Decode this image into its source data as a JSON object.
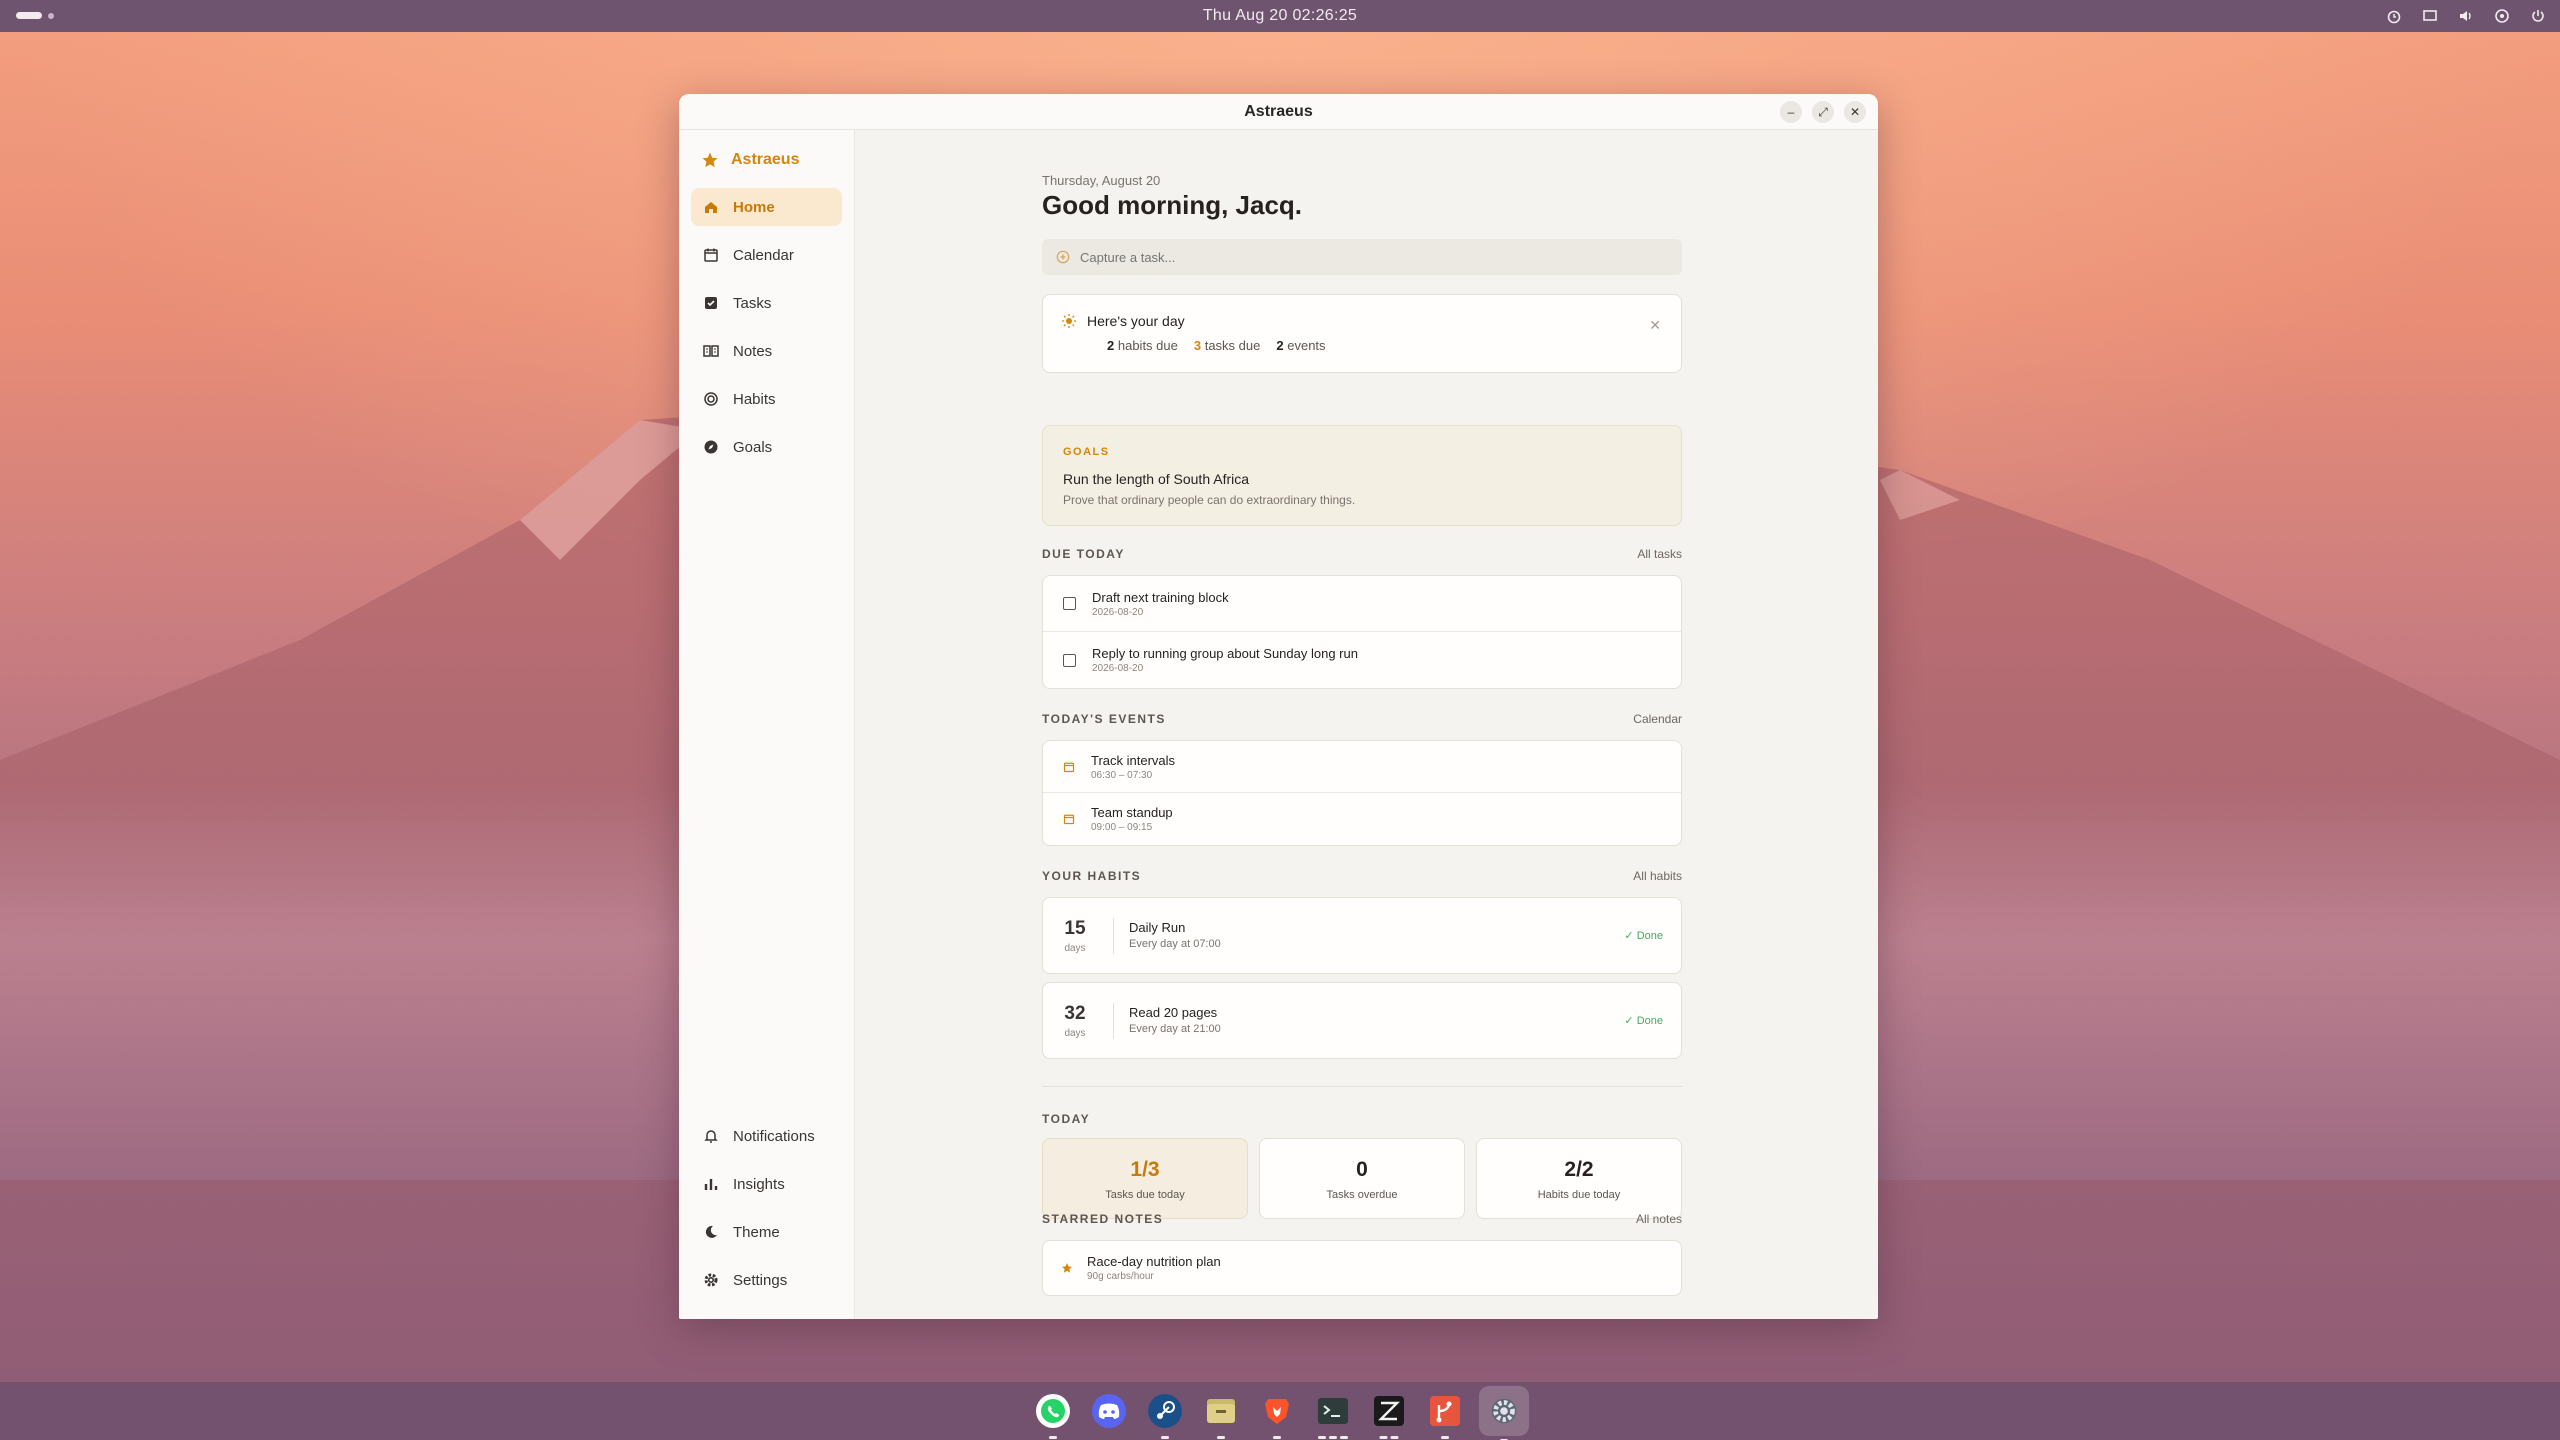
{
  "topbar": {
    "clock": "Thu Aug 20  02:26:25"
  },
  "window": {
    "title": "Astraeus"
  },
  "sidebar": {
    "brand": "Astraeus",
    "items": [
      {
        "label": "Home",
        "icon": "home-icon",
        "active": true
      },
      {
        "label": "Calendar",
        "icon": "calendar-icon"
      },
      {
        "label": "Tasks",
        "icon": "checkbox-icon"
      },
      {
        "label": "Notes",
        "icon": "notebook-icon"
      },
      {
        "label": "Habits",
        "icon": "target-icon"
      },
      {
        "label": "Goals",
        "icon": "compass-icon"
      }
    ],
    "bottom": [
      {
        "label": "Notifications",
        "icon": "bell-icon"
      },
      {
        "label": "Insights",
        "icon": "bar-chart-icon"
      },
      {
        "label": "Theme",
        "icon": "moon-icon"
      },
      {
        "label": "Settings",
        "icon": "gear-icon"
      }
    ]
  },
  "main": {
    "date": "Thursday, August 20",
    "greeting": "Good morning, Jacq.",
    "capture_placeholder": "Capture a task...",
    "day": {
      "title": "Here's your day",
      "habits_count": "2",
      "habits_label": "habits due",
      "tasks_count": "3",
      "tasks_label": "tasks due",
      "events_count": "2",
      "events_label": "events"
    },
    "goal": {
      "kicker": "GOALS",
      "title": "Run the length of South Africa",
      "subtitle": "Prove that ordinary people can do extraordinary things."
    },
    "due_today": {
      "heading": "DUE TODAY",
      "link": "All tasks",
      "tasks": [
        {
          "title": "Draft next training block",
          "date": "2026-08-20"
        },
        {
          "title": "Reply to running group about Sunday long run",
          "date": "2026-08-20"
        }
      ]
    },
    "events": {
      "heading": "TODAY'S EVENTS",
      "link": "Calendar",
      "items": [
        {
          "title": "Track intervals",
          "time": "06:30 – 07:30"
        },
        {
          "title": "Team standup",
          "time": "09:00 – 09:15"
        }
      ]
    },
    "habits": {
      "heading": "YOUR HABITS",
      "link": "All habits",
      "items": [
        {
          "streak": "15",
          "unit": "days",
          "name": "Daily Run",
          "schedule": "Every day at 07:00",
          "status": "Done"
        },
        {
          "streak": "32",
          "unit": "days",
          "name": "Read 20 pages",
          "schedule": "Every day at 21:00",
          "status": "Done"
        }
      ]
    },
    "today": {
      "heading": "TODAY",
      "stats": [
        {
          "value": "1/3",
          "label": "Tasks due today"
        },
        {
          "value": "0",
          "label": "Tasks overdue"
        },
        {
          "value": "2/2",
          "label": "Habits due today"
        }
      ]
    },
    "starred": {
      "heading": "STARRED NOTES",
      "link": "All notes",
      "items": [
        {
          "title": "Race-day nutrition plan",
          "subtitle": "90g carbs/hour"
        }
      ]
    }
  },
  "colors": {
    "accent": "#d4860d",
    "done": "#3fae5d",
    "panel": "#f5f3ef"
  }
}
